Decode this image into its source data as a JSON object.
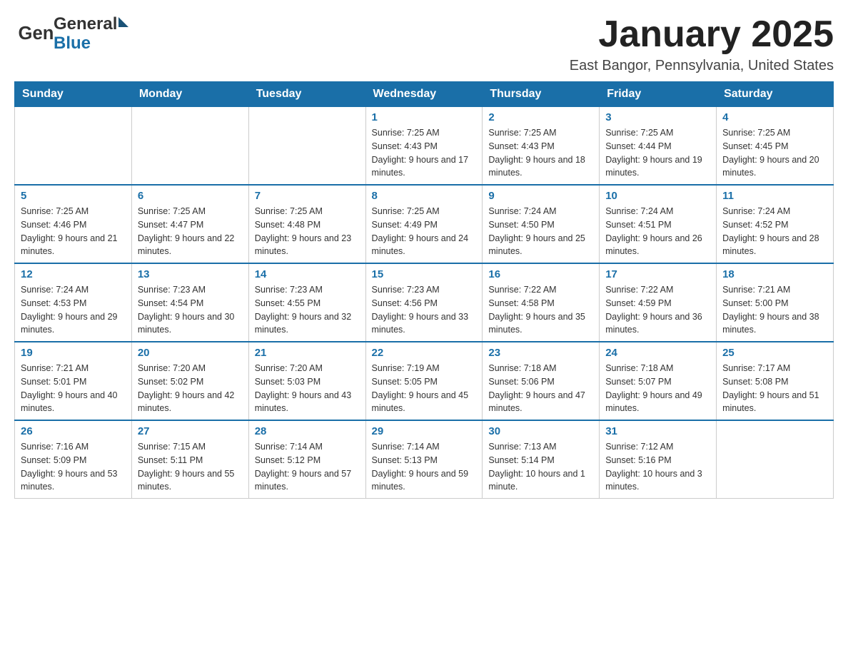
{
  "header": {
    "logo": {
      "general": "General",
      "blue": "Blue"
    },
    "title": "January 2025",
    "location": "East Bangor, Pennsylvania, United States"
  },
  "weekdays": [
    "Sunday",
    "Monday",
    "Tuesday",
    "Wednesday",
    "Thursday",
    "Friday",
    "Saturday"
  ],
  "weeks": [
    [
      {
        "day": "",
        "sunrise": "",
        "sunset": "",
        "daylight": ""
      },
      {
        "day": "",
        "sunrise": "",
        "sunset": "",
        "daylight": ""
      },
      {
        "day": "",
        "sunrise": "",
        "sunset": "",
        "daylight": ""
      },
      {
        "day": "1",
        "sunrise": "Sunrise: 7:25 AM",
        "sunset": "Sunset: 4:43 PM",
        "daylight": "Daylight: 9 hours and 17 minutes."
      },
      {
        "day": "2",
        "sunrise": "Sunrise: 7:25 AM",
        "sunset": "Sunset: 4:43 PM",
        "daylight": "Daylight: 9 hours and 18 minutes."
      },
      {
        "day": "3",
        "sunrise": "Sunrise: 7:25 AM",
        "sunset": "Sunset: 4:44 PM",
        "daylight": "Daylight: 9 hours and 19 minutes."
      },
      {
        "day": "4",
        "sunrise": "Sunrise: 7:25 AM",
        "sunset": "Sunset: 4:45 PM",
        "daylight": "Daylight: 9 hours and 20 minutes."
      }
    ],
    [
      {
        "day": "5",
        "sunrise": "Sunrise: 7:25 AM",
        "sunset": "Sunset: 4:46 PM",
        "daylight": "Daylight: 9 hours and 21 minutes."
      },
      {
        "day": "6",
        "sunrise": "Sunrise: 7:25 AM",
        "sunset": "Sunset: 4:47 PM",
        "daylight": "Daylight: 9 hours and 22 minutes."
      },
      {
        "day": "7",
        "sunrise": "Sunrise: 7:25 AM",
        "sunset": "Sunset: 4:48 PM",
        "daylight": "Daylight: 9 hours and 23 minutes."
      },
      {
        "day": "8",
        "sunrise": "Sunrise: 7:25 AM",
        "sunset": "Sunset: 4:49 PM",
        "daylight": "Daylight: 9 hours and 24 minutes."
      },
      {
        "day": "9",
        "sunrise": "Sunrise: 7:24 AM",
        "sunset": "Sunset: 4:50 PM",
        "daylight": "Daylight: 9 hours and 25 minutes."
      },
      {
        "day": "10",
        "sunrise": "Sunrise: 7:24 AM",
        "sunset": "Sunset: 4:51 PM",
        "daylight": "Daylight: 9 hours and 26 minutes."
      },
      {
        "day": "11",
        "sunrise": "Sunrise: 7:24 AM",
        "sunset": "Sunset: 4:52 PM",
        "daylight": "Daylight: 9 hours and 28 minutes."
      }
    ],
    [
      {
        "day": "12",
        "sunrise": "Sunrise: 7:24 AM",
        "sunset": "Sunset: 4:53 PM",
        "daylight": "Daylight: 9 hours and 29 minutes."
      },
      {
        "day": "13",
        "sunrise": "Sunrise: 7:23 AM",
        "sunset": "Sunset: 4:54 PM",
        "daylight": "Daylight: 9 hours and 30 minutes."
      },
      {
        "day": "14",
        "sunrise": "Sunrise: 7:23 AM",
        "sunset": "Sunset: 4:55 PM",
        "daylight": "Daylight: 9 hours and 32 minutes."
      },
      {
        "day": "15",
        "sunrise": "Sunrise: 7:23 AM",
        "sunset": "Sunset: 4:56 PM",
        "daylight": "Daylight: 9 hours and 33 minutes."
      },
      {
        "day": "16",
        "sunrise": "Sunrise: 7:22 AM",
        "sunset": "Sunset: 4:58 PM",
        "daylight": "Daylight: 9 hours and 35 minutes."
      },
      {
        "day": "17",
        "sunrise": "Sunrise: 7:22 AM",
        "sunset": "Sunset: 4:59 PM",
        "daylight": "Daylight: 9 hours and 36 minutes."
      },
      {
        "day": "18",
        "sunrise": "Sunrise: 7:21 AM",
        "sunset": "Sunset: 5:00 PM",
        "daylight": "Daylight: 9 hours and 38 minutes."
      }
    ],
    [
      {
        "day": "19",
        "sunrise": "Sunrise: 7:21 AM",
        "sunset": "Sunset: 5:01 PM",
        "daylight": "Daylight: 9 hours and 40 minutes."
      },
      {
        "day": "20",
        "sunrise": "Sunrise: 7:20 AM",
        "sunset": "Sunset: 5:02 PM",
        "daylight": "Daylight: 9 hours and 42 minutes."
      },
      {
        "day": "21",
        "sunrise": "Sunrise: 7:20 AM",
        "sunset": "Sunset: 5:03 PM",
        "daylight": "Daylight: 9 hours and 43 minutes."
      },
      {
        "day": "22",
        "sunrise": "Sunrise: 7:19 AM",
        "sunset": "Sunset: 5:05 PM",
        "daylight": "Daylight: 9 hours and 45 minutes."
      },
      {
        "day": "23",
        "sunrise": "Sunrise: 7:18 AM",
        "sunset": "Sunset: 5:06 PM",
        "daylight": "Daylight: 9 hours and 47 minutes."
      },
      {
        "day": "24",
        "sunrise": "Sunrise: 7:18 AM",
        "sunset": "Sunset: 5:07 PM",
        "daylight": "Daylight: 9 hours and 49 minutes."
      },
      {
        "day": "25",
        "sunrise": "Sunrise: 7:17 AM",
        "sunset": "Sunset: 5:08 PM",
        "daylight": "Daylight: 9 hours and 51 minutes."
      }
    ],
    [
      {
        "day": "26",
        "sunrise": "Sunrise: 7:16 AM",
        "sunset": "Sunset: 5:09 PM",
        "daylight": "Daylight: 9 hours and 53 minutes."
      },
      {
        "day": "27",
        "sunrise": "Sunrise: 7:15 AM",
        "sunset": "Sunset: 5:11 PM",
        "daylight": "Daylight: 9 hours and 55 minutes."
      },
      {
        "day": "28",
        "sunrise": "Sunrise: 7:14 AM",
        "sunset": "Sunset: 5:12 PM",
        "daylight": "Daylight: 9 hours and 57 minutes."
      },
      {
        "day": "29",
        "sunrise": "Sunrise: 7:14 AM",
        "sunset": "Sunset: 5:13 PM",
        "daylight": "Daylight: 9 hours and 59 minutes."
      },
      {
        "day": "30",
        "sunrise": "Sunrise: 7:13 AM",
        "sunset": "Sunset: 5:14 PM",
        "daylight": "Daylight: 10 hours and 1 minute."
      },
      {
        "day": "31",
        "sunrise": "Sunrise: 7:12 AM",
        "sunset": "Sunset: 5:16 PM",
        "daylight": "Daylight: 10 hours and 3 minutes."
      },
      {
        "day": "",
        "sunrise": "",
        "sunset": "",
        "daylight": ""
      }
    ]
  ]
}
